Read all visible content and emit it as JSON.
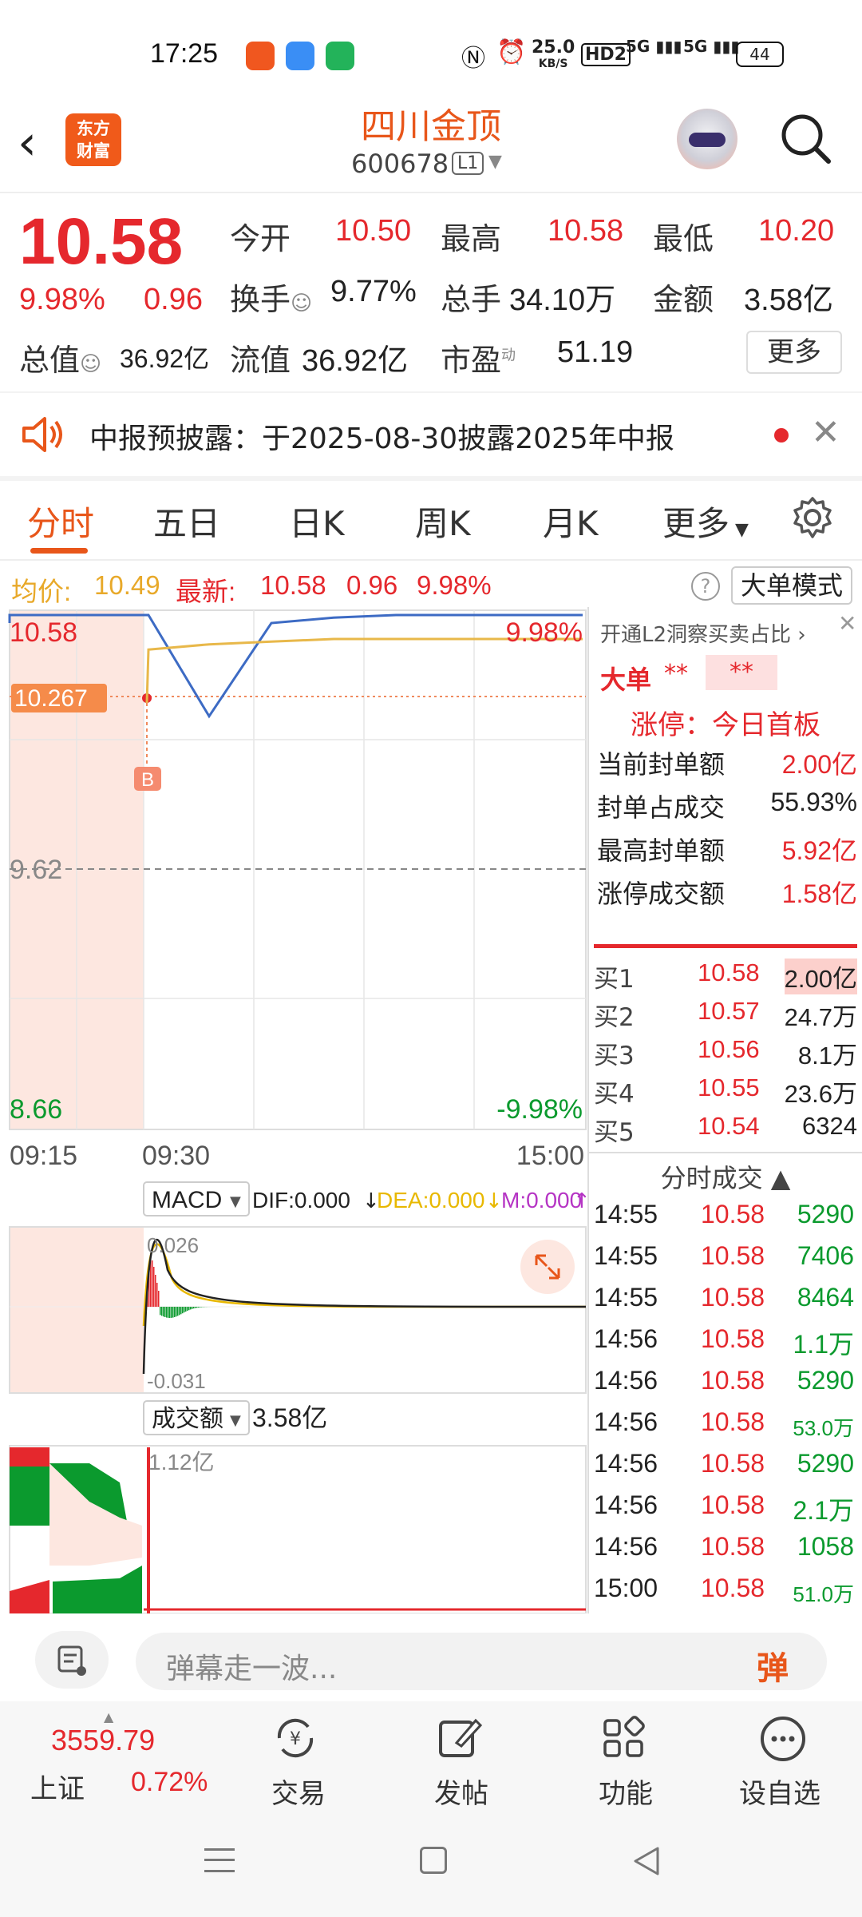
{
  "status_bar": {
    "time": "17:25",
    "net_speed": "25.0",
    "net_unit": "KB/S",
    "hd": "HD2",
    "sig1": "5G",
    "sig2": "5G",
    "battery": "44"
  },
  "header": {
    "logo_line1": "东方",
    "logo_line2": "财富",
    "title": "四川金顶",
    "code": "600678",
    "level": "L1"
  },
  "quote": {
    "price": "10.58",
    "change_pct": "9.98%",
    "change": "0.96",
    "open_label": "今开",
    "open": "10.50",
    "high_label": "最高",
    "high": "10.58",
    "low_label": "最低",
    "low": "10.20",
    "turnover_label": "换手",
    "turnover": "9.77%",
    "volume_label": "总手",
    "volume": "34.10万",
    "amount_label": "金额",
    "amount": "3.58亿",
    "mktcap_label": "总值",
    "mktcap": "36.92亿",
    "float_label": "流值",
    "float_cap": "36.92亿",
    "pe_label": "市盈",
    "pe_sup": "动",
    "pe": "51.19",
    "more": "更多"
  },
  "notice": {
    "text": "中报预披露：于2025-08-30披露2025年中报"
  },
  "tabs": [
    "分时",
    "五日",
    "日K",
    "周K",
    "月K",
    "更多"
  ],
  "info_line": {
    "avg_label": "均价:",
    "avg": "10.49",
    "latest_label": "最新:",
    "latest": "10.58",
    "change": "0.96",
    "pct": "9.98%",
    "mode_btn": "大单模式"
  },
  "chart": {
    "y_top": "10.58",
    "y_mid": "9.62",
    "y_bottom": "8.66",
    "pct_top": "9.98%",
    "pct_bottom": "-9.98%",
    "marker_price": "10.267",
    "marker_letter": "B",
    "x_labels": [
      "09:15",
      "09:30",
      "15:00"
    ],
    "macd_label": "MACD",
    "dif": "DIF:0.000",
    "dea": "DEA:0.000",
    "m": "M:0.000",
    "macd_top": "0.026",
    "macd_bottom": "-0.031",
    "vol_label": "成交额",
    "vol_total": "3.58亿",
    "vol_max": "1.12亿"
  },
  "chart_data": {
    "type": "line",
    "series": [
      {
        "name": "最新",
        "values": [
          10.58,
          10.58,
          10.2,
          10.55,
          10.57,
          10.58,
          10.58,
          10.58,
          10.58
        ]
      },
      {
        "name": "均价",
        "values": [
          10.25,
          10.45,
          10.47,
          10.48,
          10.49,
          10.49,
          10.49,
          10.49,
          10.49
        ]
      }
    ],
    "x": [
      "09:30",
      "",
      "",
      "",
      "",
      "",
      "",
      "",
      "15:00"
    ],
    "ylim": [
      8.66,
      10.58
    ]
  },
  "side": {
    "l2_text": "开通L2洞察买卖占比",
    "big_order": "大单",
    "stars1": "**",
    "stars2": "**",
    "limit_title": "涨停：今日首板",
    "limit_rows": [
      {
        "label": "当前封单额",
        "value": "2.00亿"
      },
      {
        "label": "封单占成交",
        "value": "55.93%"
      },
      {
        "label": "最高封单额",
        "value": "5.92亿"
      },
      {
        "label": "涨停成交额",
        "value": "1.58亿"
      }
    ],
    "bids": [
      {
        "label": "买1",
        "price": "10.58",
        "vol": "2.00亿"
      },
      {
        "label": "买2",
        "price": "10.57",
        "vol": "24.7万"
      },
      {
        "label": "买3",
        "price": "10.56",
        "vol": "8.1万"
      },
      {
        "label": "买4",
        "price": "10.55",
        "vol": "23.6万"
      },
      {
        "label": "买5",
        "price": "10.54",
        "vol": "6324"
      }
    ],
    "ticks_title": "分时成交",
    "ticks": [
      {
        "t": "14:55",
        "p": "10.58",
        "v": "5290"
      },
      {
        "t": "14:55",
        "p": "10.58",
        "v": "7406"
      },
      {
        "t": "14:55",
        "p": "10.58",
        "v": "8464"
      },
      {
        "t": "14:56",
        "p": "10.58",
        "v": "1.1万"
      },
      {
        "t": "14:56",
        "p": "10.58",
        "v": "5290"
      },
      {
        "t": "14:56",
        "p": "10.58",
        "v": "53.0万"
      },
      {
        "t": "14:56",
        "p": "10.58",
        "v": "5290"
      },
      {
        "t": "14:56",
        "p": "10.58",
        "v": "2.1万"
      },
      {
        "t": "14:56",
        "p": "10.58",
        "v": "1058"
      },
      {
        "t": "15:00",
        "p": "10.58",
        "v": "51.0万"
      }
    ]
  },
  "comment": {
    "placeholder": "弹幕走一波...",
    "danmu_btn": "弹"
  },
  "bottom_nav": {
    "index_value": "3559.79",
    "index_name": "上证",
    "index_pct": "0.72%",
    "items": [
      "交易",
      "发帖",
      "功能",
      "设自选"
    ]
  }
}
